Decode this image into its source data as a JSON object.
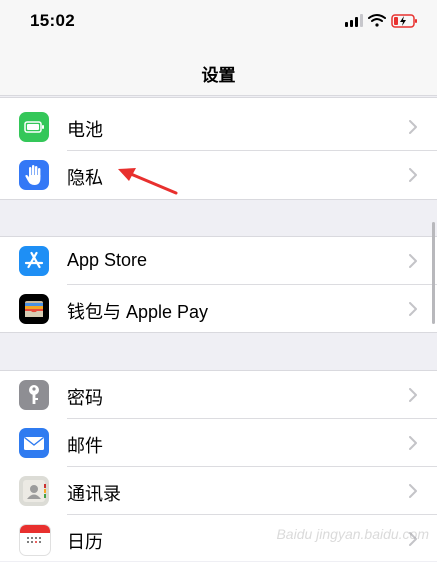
{
  "status_bar": {
    "time": "15:02"
  },
  "nav": {
    "title": "设置"
  },
  "groups": [
    {
      "items": [
        {
          "label": "电池",
          "icon": "battery-icon"
        },
        {
          "label": "隐私",
          "icon": "privacy-hand-icon"
        }
      ]
    },
    {
      "items": [
        {
          "label": "App Store",
          "icon": "app-store-icon"
        },
        {
          "label": "钱包与 Apple Pay",
          "icon": "wallet-icon"
        }
      ]
    },
    {
      "items": [
        {
          "label": "密码",
          "icon": "key-icon"
        },
        {
          "label": "邮件",
          "icon": "mail-icon"
        },
        {
          "label": "通讯录",
          "icon": "contacts-icon"
        },
        {
          "label": "日历",
          "icon": "calendar-icon"
        }
      ]
    }
  ],
  "colors": {
    "battery_green": "#34c759",
    "privacy_blue": "#3478f6",
    "app_store_blue": "#1e8ff5",
    "mail_blue": "#2f7bf0",
    "key_gray": "#8e8e93",
    "annotation_red": "#e8302e"
  },
  "watermark": "Baidu jingyan.baidu.com"
}
